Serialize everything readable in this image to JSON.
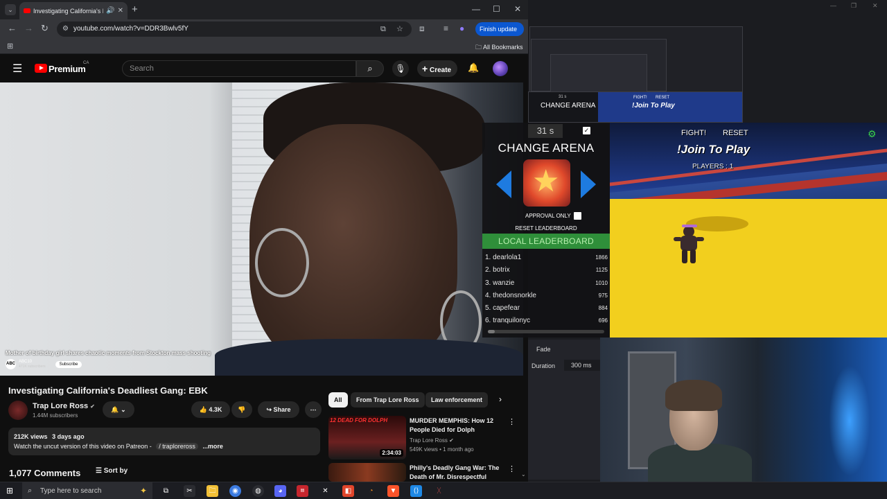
{
  "browser": {
    "tab_title": "Investigating California's De",
    "new_tab_symbol": "+",
    "url": "youtube.com/watch?v=DDR3Bwlv5fY",
    "finish_update_label": "Finish update",
    "all_bookmarks_label": "All Bookmarks"
  },
  "youtube": {
    "brand": "Premium",
    "region": "CA",
    "search_placeholder": "Search",
    "create_label": "Create",
    "video": {
      "caption": "Mother of birthday girl shares chaotic moments from Stockton mass shooting",
      "news_channel": "ABC10",
      "news_logo_text": "ABC",
      "news_subscribers": "471K subscribers",
      "news_subscribe": "Subscribe"
    },
    "title": "Investigating California's Deadliest Gang: EBK",
    "channel_name": "Trap Lore Ross",
    "subscribers": "1.44M subscribers",
    "likes": "4.3K",
    "share_label": "Share",
    "views": "212K views",
    "age": "3 days ago",
    "description": "Watch the uncut version of this video on Patreon -",
    "patreon_link": "/ traploreross",
    "more_label": "...more",
    "comments_count": "1,077 Comments",
    "sort_label": "Sort by",
    "chips": [
      "All",
      "From Trap Lore Ross",
      "Law enforcement"
    ],
    "recommendations": [
      {
        "title": "MURDER MEMPHIS: How 12 People Died for Dolph",
        "channel": "Trap Lore Ross",
        "meta": "549K views • 1 month ago",
        "duration": "2:34:03",
        "thumb_text": "12 DEAD FOR DOLPH"
      },
      {
        "title": "Philly's Deadly Gang War: The Death of Mr. Disrespectful",
        "channel": "",
        "meta": "",
        "duration": "",
        "thumb_text": ""
      }
    ]
  },
  "stream": {
    "mirror_arena_label": "CHANGE ARENA",
    "mirror_timer": "31 s",
    "mirror_fight": "FIGHT!",
    "mirror_reset": "RESET",
    "mirror_join": "!Join To Play",
    "panel": {
      "timer": "31 s",
      "check_mark": "✓",
      "arena_title": "CHANGE ARENA",
      "approval_label": "APPROVAL ONLY",
      "reset_leaderboard": "RESET LEADERBOARD",
      "local_leaderboard": "LOCAL LEADERBOARD",
      "leaderboard": [
        {
          "rank": "1.",
          "name": "dearlola1",
          "score": "1866"
        },
        {
          "rank": "2.",
          "name": "botrix",
          "score": "1125"
        },
        {
          "rank": "3.",
          "name": "wanzie",
          "score": "1010"
        },
        {
          "rank": "4.",
          "name": "thedonsnorkle",
          "score": "975"
        },
        {
          "rank": "5.",
          "name": "capefear",
          "score": "884"
        },
        {
          "rank": "6.",
          "name": "tranquilonyc",
          "score": "696"
        }
      ]
    },
    "game": {
      "fight_label": "FIGHT!",
      "reset_label": "RESET",
      "join_label": "!Join To Play",
      "players_label": "PLAYERS : 1"
    },
    "transition": {
      "fade_label": "Fade",
      "duration_label": "Duration",
      "duration_value": "300 ms"
    }
  },
  "taskbar": {
    "search_placeholder": "Type here to search",
    "apps": [
      {
        "name": "task-view",
        "color": "#2b2c31"
      },
      {
        "name": "capcut",
        "color": "#2b2c31"
      },
      {
        "name": "file-explorer",
        "color": "#f2c037"
      },
      {
        "name": "chrome",
        "color": "#3c7be0"
      },
      {
        "name": "obs",
        "color": "#2b2c31"
      },
      {
        "name": "discord",
        "color": "#5865f2"
      },
      {
        "name": "app-red",
        "color": "#c6262e"
      },
      {
        "name": "app-x",
        "color": "#2b2c31"
      },
      {
        "name": "app-orange",
        "color": "#e0452b"
      },
      {
        "name": "blender",
        "color": "#2b2c31"
      },
      {
        "name": "brave",
        "color": "#fb542b"
      },
      {
        "name": "vscode",
        "color": "#1e88e5"
      },
      {
        "name": "app-dark",
        "color": "#2b2c31"
      }
    ]
  },
  "colors": {
    "youtube_red": "#ff0000",
    "chrome_blue": "#0b57d0",
    "leaderboard_green": "#2f8f3a",
    "arrow_blue": "#1e7be0",
    "arena_floor": "#f2cf1e",
    "settings_green": "#39d14a"
  }
}
